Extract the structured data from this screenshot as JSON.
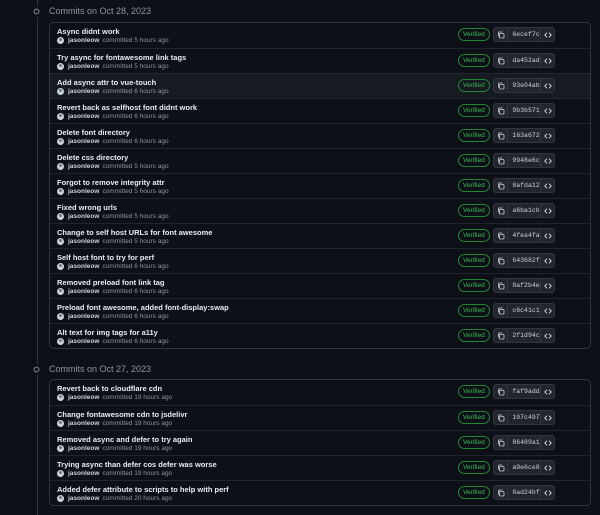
{
  "groups": [
    {
      "title": "Commits on Oct 28, 2023",
      "commits": [
        {
          "message": "Async didnt work",
          "author": "jasonleow",
          "time": "committed 5 hours ago",
          "badge": "Verified",
          "sha": "6ecef7c"
        },
        {
          "message": "Try async for fontawesome link tags",
          "author": "jasonleow",
          "time": "committed 5 hours ago",
          "badge": "Verified",
          "sha": "da452ad"
        },
        {
          "message": "Add async attr to vue-touch",
          "author": "jasonleow",
          "time": "committed 6 hours ago",
          "badge": "Verified",
          "sha": "93e04ab"
        },
        {
          "message": "Revert back as selfhost font didnt work",
          "author": "jasonleow",
          "time": "committed 6 hours ago",
          "badge": "Verified",
          "sha": "9b3b571"
        },
        {
          "message": "Delete font directory",
          "author": "jasonleow",
          "time": "committed 6 hours ago",
          "badge": "Verified",
          "sha": "163a672"
        },
        {
          "message": "Delete css directory",
          "author": "jasonleow",
          "time": "committed 5 hours ago",
          "badge": "Verified",
          "sha": "9948e6c"
        },
        {
          "message": "Forgot to remove integrity attr",
          "author": "jasonleow",
          "time": "committed 5 hours ago",
          "badge": "Verified",
          "sha": "8afda12"
        },
        {
          "message": "Fixed wrong urls",
          "author": "jasonleow",
          "time": "committed 5 hours ago",
          "badge": "Verified",
          "sha": "a6ba1cb"
        },
        {
          "message": "Change to self host URLs for font awesome",
          "author": "jasonleow",
          "time": "committed 5 hours ago",
          "badge": "Verified",
          "sha": "4fea4fa"
        },
        {
          "message": "Self host font to try for perf",
          "author": "jasonleow",
          "time": "committed 6 hours ago",
          "badge": "Verified",
          "sha": "643682f"
        },
        {
          "message": "Removed preload font link tag",
          "author": "jasonleow",
          "time": "committed 6 hours ago",
          "badge": "Verified",
          "sha": "8af2b4e"
        },
        {
          "message": "Preload font awesome, added font-display:swap",
          "author": "jasonleow",
          "time": "committed 6 hours ago",
          "badge": "Verified",
          "sha": "c6c41c1"
        },
        {
          "message": "Alt text for img tags for a11y",
          "author": "jasonleow",
          "time": "committed 6 hours ago",
          "badge": "Verified",
          "sha": "2f1d94c"
        }
      ]
    },
    {
      "title": "Commits on Oct 27, 2023",
      "commits": [
        {
          "message": "Revert back to cloudflare cdn",
          "author": "jasonleow",
          "time": "committed 19 hours ago",
          "badge": "Verified",
          "sha": "faf9add"
        },
        {
          "message": "Change fontawesome cdn to jsdelivr",
          "author": "jasonleow",
          "time": "committed 19 hours ago",
          "badge": "Verified",
          "sha": "107c497"
        },
        {
          "message": "Removed async and defer to try again",
          "author": "jasonleow",
          "time": "committed 19 hours ago",
          "badge": "Verified",
          "sha": "86489a1"
        },
        {
          "message": "Trying async than defer cos defer was worse",
          "author": "jasonleow",
          "time": "committed 19 hours ago",
          "badge": "Verified",
          "sha": "a9e6ce8"
        },
        {
          "message": "Added defer attribute to scripts to help with perf",
          "author": "jasonleow",
          "time": "committed 20 hours ago",
          "badge": "Verified",
          "sha": "8ad24bf"
        }
      ]
    }
  ],
  "highlighted_row": "93e04ab",
  "icons": {
    "timeline": "git-commit-icon",
    "copy": "copy-icon",
    "browse": "code-icon"
  },
  "colors": {
    "background": "#0d1117",
    "border": "#30363d",
    "verified": "#3fb950",
    "text": "#e6edf3",
    "muted": "#8b949e"
  }
}
